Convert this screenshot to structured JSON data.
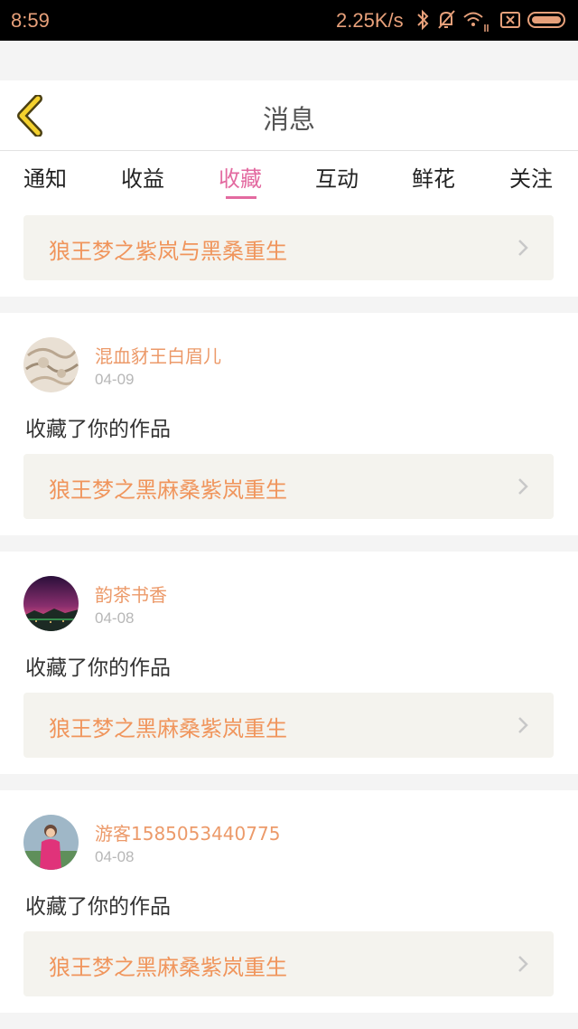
{
  "status": {
    "time": "8:59",
    "speed": "2.25K/s"
  },
  "header": {
    "title": "消息"
  },
  "tabs": [
    "通知",
    "收益",
    "收藏",
    "互动",
    "鲜花",
    "关注"
  ],
  "active_tab": "收藏",
  "messages": [
    {
      "work": "狼王梦之紫岚与黑桑重生"
    },
    {
      "user": "混血豺王白眉儿",
      "date": "04-09",
      "action": "收藏了你的作品",
      "work": "狼王梦之黑麻桑紫岚重生"
    },
    {
      "user": "韵茶书香",
      "date": "04-08",
      "action": "收藏了你的作品",
      "work": "狼王梦之黑麻桑紫岚重生"
    },
    {
      "user": "游客1585053440775",
      "date": "04-08",
      "action": "收藏了你的作品",
      "work": "狼王梦之黑麻桑紫岚重生"
    }
  ],
  "colors": {
    "accent": "#e36aa0",
    "orange": "#f0955c"
  }
}
